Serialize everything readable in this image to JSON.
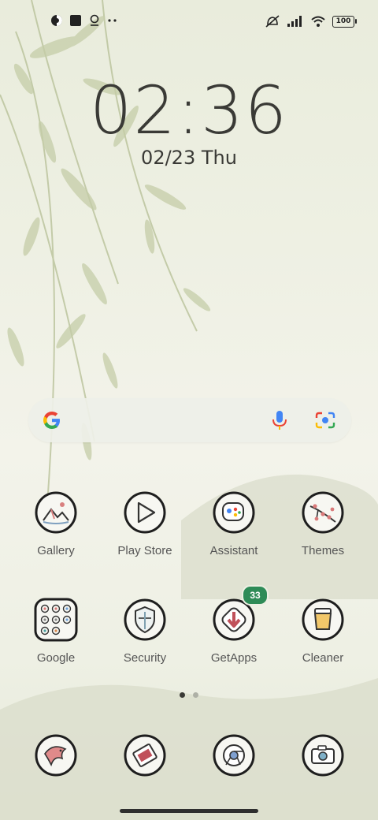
{
  "status": {
    "battery": "100",
    "icons_left": [
      "notification-icon",
      "square-icon",
      "location-pin-icon",
      "more-dots-icon"
    ],
    "icons_right": [
      "silent-icon",
      "signal-icon",
      "wifi-icon",
      "battery-icon"
    ]
  },
  "clock": {
    "time": "02:36",
    "date": "02/23",
    "day": "Thu"
  },
  "search": {
    "icons": [
      "google-g-icon",
      "mic-icon",
      "lens-icon"
    ]
  },
  "apps": [
    {
      "label": "Gallery"
    },
    {
      "label": "Play Store"
    },
    {
      "label": "Assistant"
    },
    {
      "label": "Themes"
    },
    {
      "label": "Google"
    },
    {
      "label": "Security"
    },
    {
      "label": "GetApps",
      "badge": "33"
    },
    {
      "label": "Cleaner"
    }
  ],
  "dock": [
    {
      "icon": "fish-icon"
    },
    {
      "icon": "messages-icon"
    },
    {
      "icon": "chrome-icon"
    },
    {
      "icon": "camera-icon"
    }
  ],
  "pages": {
    "current": 1,
    "total": 2
  },
  "colors": {
    "badge": "#2e8b57",
    "text": "#3a3a36",
    "label": "#555555"
  }
}
